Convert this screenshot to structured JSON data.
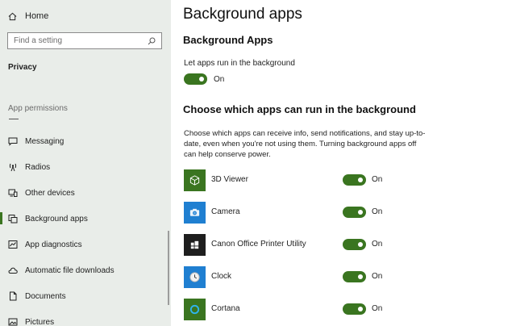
{
  "sidebar": {
    "home_label": "Home",
    "search_placeholder": "Find a setting",
    "section_title": "Privacy",
    "group_label": "App permissions",
    "items": [
      {
        "label": "Messaging",
        "icon": "message-icon"
      },
      {
        "label": "Radios",
        "icon": "radio-icon"
      },
      {
        "label": "Other devices",
        "icon": "devices-icon"
      },
      {
        "label": "Background apps",
        "icon": "background-apps-icon",
        "active": true
      },
      {
        "label": "App diagnostics",
        "icon": "diagnostics-icon"
      },
      {
        "label": "Automatic file downloads",
        "icon": "cloud-icon"
      },
      {
        "label": "Documents",
        "icon": "document-icon"
      },
      {
        "label": "Pictures",
        "icon": "pictures-icon"
      }
    ]
  },
  "main": {
    "page_title": "Background apps",
    "section1_title": "Background Apps",
    "run_label": "Let apps run in the background",
    "run_state": "On",
    "section2_title": "Choose which apps can run in the background",
    "description": "Choose which apps can receive info, send notifications, and stay up-to-date, even when you're not using them. Turning background apps off can help conserve power.",
    "apps": [
      {
        "name": "3D Viewer",
        "state": "On",
        "tile_color": "#3a7520",
        "icon": "cube-icon"
      },
      {
        "name": "Camera",
        "state": "On",
        "tile_color": "#1f7fd1",
        "icon": "camera-icon"
      },
      {
        "name": "Canon Office Printer Utility",
        "state": "On",
        "tile_color": "#1e1e1e",
        "icon": "printer-icon"
      },
      {
        "name": "Clock",
        "state": "On",
        "tile_color": "#1f7fd1",
        "icon": "clock-icon"
      },
      {
        "name": "Cortana",
        "state": "On",
        "tile_color": "#3a7520",
        "icon": "cortana-icon"
      }
    ]
  },
  "colors": {
    "accent": "#3a7520",
    "sidebar_bg": "#e9ede9"
  }
}
